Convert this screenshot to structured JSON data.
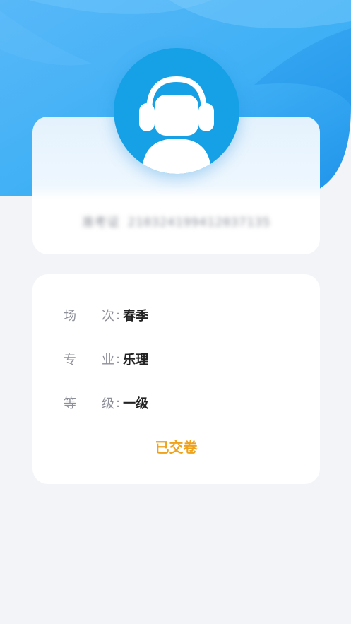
{
  "profile": {
    "avatar_icon": "headset-user-icon",
    "masked_id": "准考证 210324199412037135"
  },
  "exam": {
    "rows": [
      {
        "label_a": "场",
        "label_b": "次",
        "value": "春季"
      },
      {
        "label_a": "专",
        "label_b": "业",
        "value": "乐理"
      },
      {
        "label_a": "等",
        "label_b": "级",
        "value": "一级"
      }
    ],
    "colon": ":",
    "status": "已交卷"
  },
  "colors": {
    "accent_blue": "#16a0e6",
    "status_orange": "#efa21c",
    "background": "#f3f4f8"
  }
}
